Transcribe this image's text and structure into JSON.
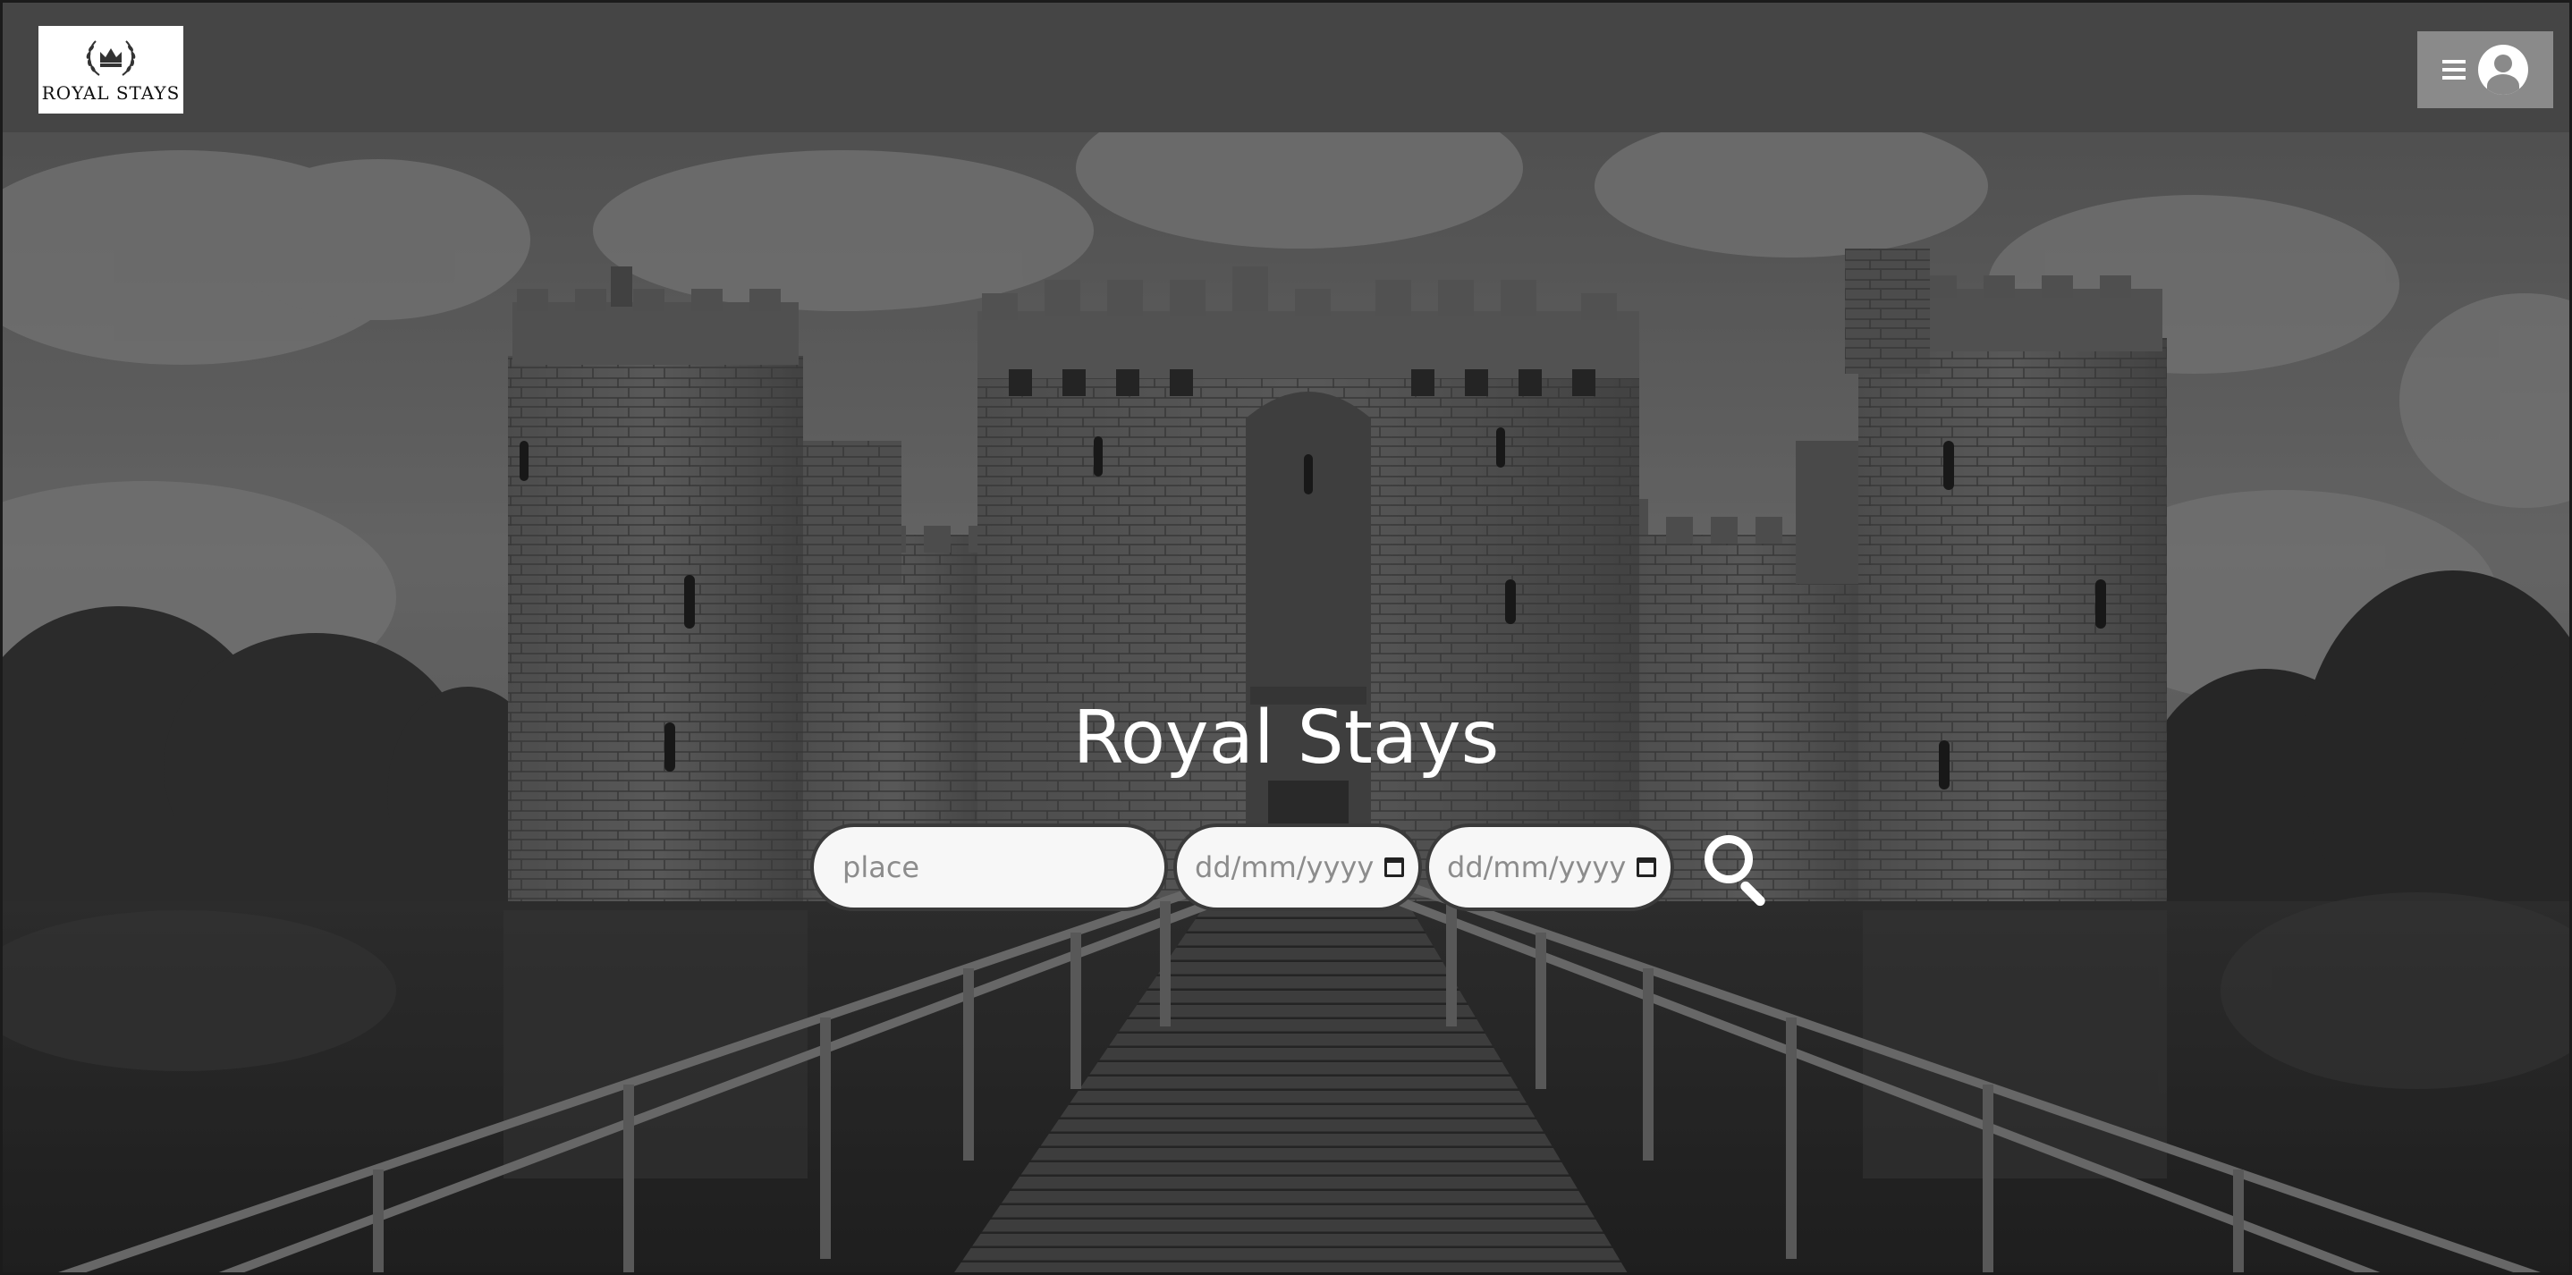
{
  "header": {
    "logo_text": "ROYAL STAYS",
    "logo_icon": "crown-laurel-icon",
    "menu_icon": "hamburger-icon",
    "account_icon": "user-avatar-icon"
  },
  "hero": {
    "title": "Royal Stays",
    "background": "grayscale-castle-with-moat-and-bridge"
  },
  "search": {
    "place_placeholder": "place",
    "checkin_placeholder": "dd/mm/yyyy",
    "checkout_placeholder": "dd/mm/yyyy",
    "search_icon": "magnifier-icon"
  },
  "colors": {
    "topbar": "#454545",
    "menu_button": "#8a8a8a",
    "input_bg": "#f7f7f7",
    "title": "#ffffff"
  }
}
